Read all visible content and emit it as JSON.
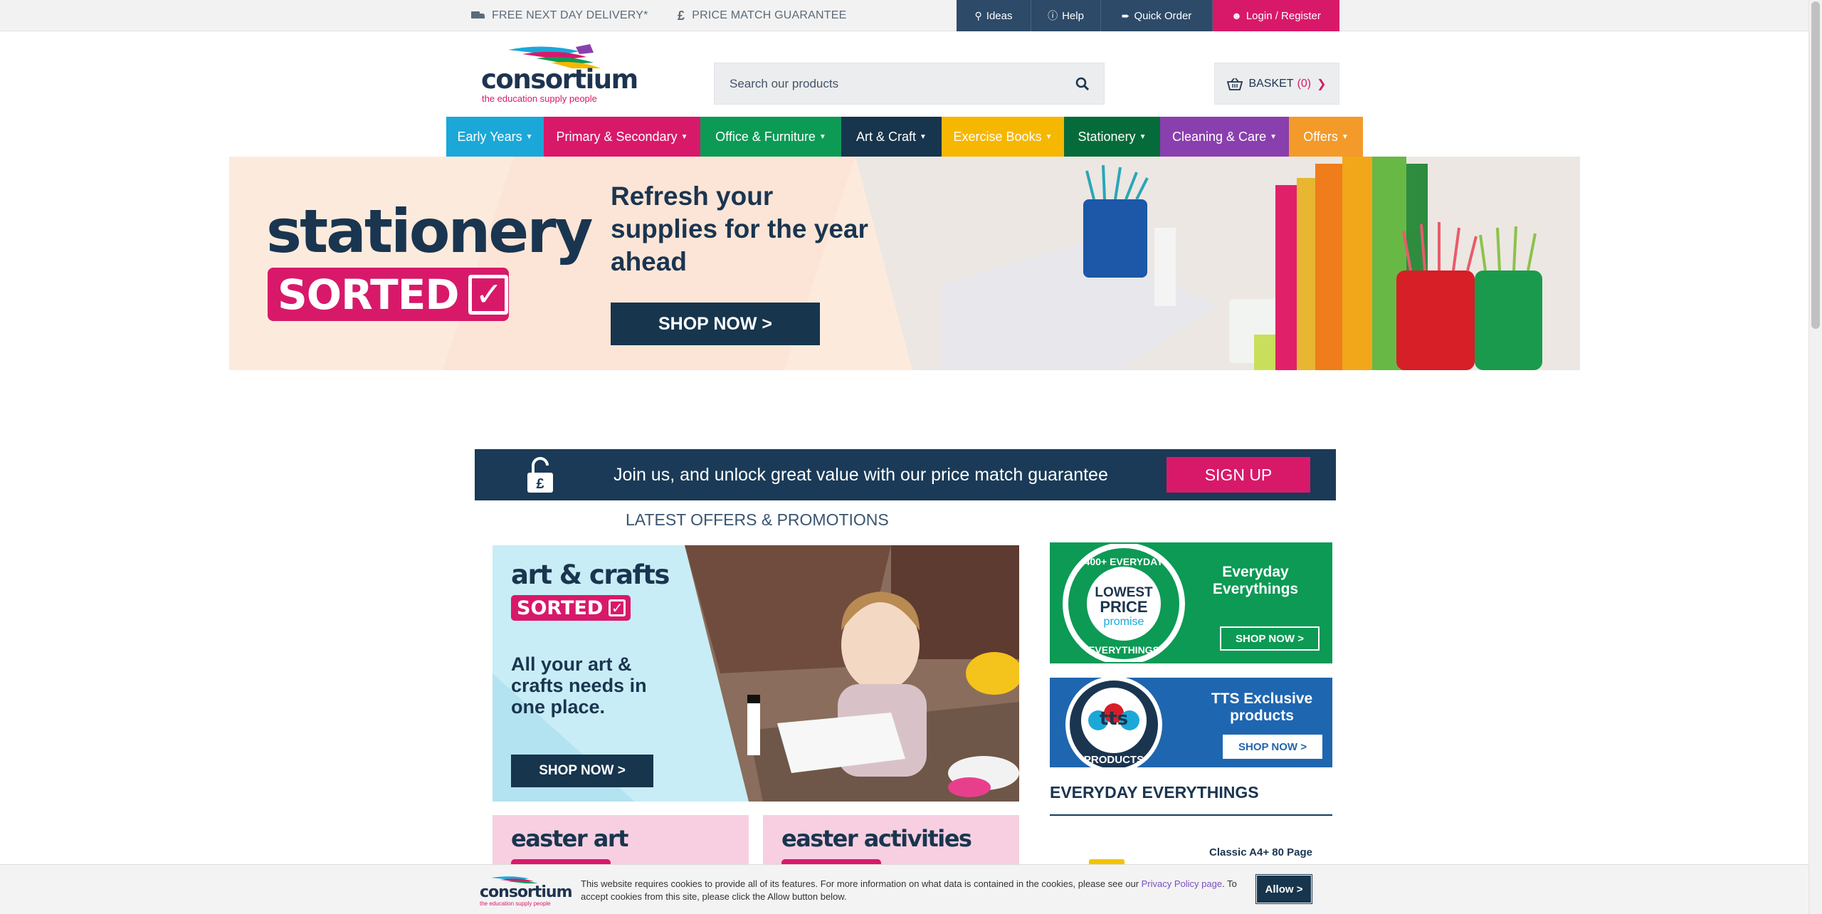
{
  "topbar": {
    "delivery": "FREE NEXT DAY DELIVERY*",
    "price_match": "PRICE MATCH GUARANTEE",
    "price_match_symbol": "£",
    "links": [
      {
        "label": "Ideas",
        "icon": "map-marker-icon",
        "glyph": "⚲",
        "bg": "#2d4a68"
      },
      {
        "label": "Help",
        "icon": "info-icon",
        "glyph": "ℹ",
        "bg": "#2d4a68"
      },
      {
        "label": "Quick Order",
        "icon": "arrow-circle-icon",
        "glyph": "➜",
        "bg": "#2d4a68"
      },
      {
        "label": "Login / Register",
        "icon": "user-icon",
        "glyph": "👤",
        "bg": "#d8196a"
      }
    ]
  },
  "header": {
    "logo_word": "consortium",
    "logo_tagline": "the education supply people",
    "search_placeholder": "Search our products",
    "basket_label": "BASKET",
    "basket_count": "(0)"
  },
  "nav": [
    {
      "label": "Early Years",
      "color": "#1ba8d8"
    },
    {
      "label": "Primary & Secondary",
      "color": "#d8196a"
    },
    {
      "label": "Office & Furniture",
      "color": "#0c9a55"
    },
    {
      "label": "Art & Craft",
      "color": "#17354d"
    },
    {
      "label": "Exercise Books",
      "color": "#f6b700"
    },
    {
      "label": "Stationery",
      "color": "#066b3a"
    },
    {
      "label": "Cleaning & Care",
      "color": "#8a3fae"
    },
    {
      "label": "Offers",
      "color": "#f39a2a"
    }
  ],
  "hero": {
    "title": "stationery",
    "badge": "SORTED",
    "copy": "Refresh your supplies for the year ahead",
    "cta": "SHOP NOW >"
  },
  "join": {
    "text": "Join us, and unlock great value with our price match guarantee",
    "cta": "SIGN UP"
  },
  "promos": {
    "title": "LATEST OFFERS & PROMOTIONS",
    "art": {
      "heading": "art & crafts",
      "badge": "SORTED",
      "text": "All your art & crafts needs in one place.",
      "cta": "SHOP NOW >"
    },
    "easter_art": "easter art",
    "easter_activities": "easter activities",
    "everyday": {
      "title": "Everyday Everythings",
      "badge_top": "400+ EVERYDAY",
      "badge_mid1": "LOWEST",
      "badge_mid2": "PRICE",
      "badge_mid3": "promise",
      "badge_bottom": "EVERYTHINGS",
      "cta": "SHOP NOW >"
    },
    "tts": {
      "title": "TTS Exclusive products",
      "logo_text": "tts",
      "logo_sub": "PRODUCTS",
      "cta": "SHOP NOW >"
    }
  },
  "everyday_section": {
    "heading": "EVERYDAY EVERYTHINGS",
    "product": "Classic A4+ 80 Page"
  },
  "cookie": {
    "logo_word": "consortium",
    "logo_tagline": "the education supply people",
    "text_before": "This website requires cookies to provide all of its features. For more information on what data is contained in the cookies, please see our ",
    "link": "Privacy Policy page",
    "text_after": ". To accept cookies from this site, please click the Allow button below.",
    "allow": "Allow >"
  }
}
